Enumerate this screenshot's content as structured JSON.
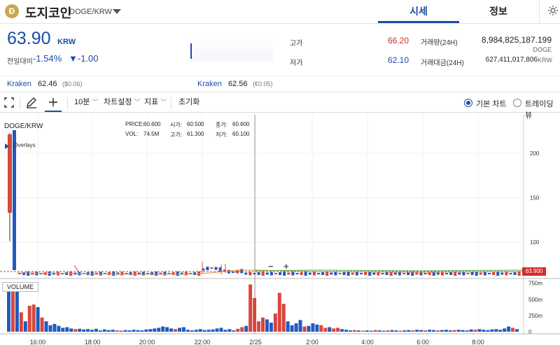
{
  "header": {
    "coin_symbol_glyph": "Ð",
    "coin_name": "도지코인",
    "pair": "DOGE/KRW",
    "tabs": [
      {
        "label": "시세",
        "active": true
      },
      {
        "label": "정보",
        "active": false
      }
    ]
  },
  "price": {
    "current": "63.90",
    "unit": "KRW",
    "change_label": "전일대비",
    "change_rate": "-1.54%",
    "change_amount": "▼-1.00"
  },
  "stats": {
    "high_label": "고가",
    "high_value": "66.20",
    "low_label": "저가",
    "low_value": "62.10",
    "volume_label": "거래량(24H)",
    "volume_value": "8,984,825,187.199",
    "volume_unit": "DOGE",
    "amount_label": "거래대금(24H)",
    "amount_value": "627,411,017,806",
    "amount_unit": "KRW"
  },
  "exchanges": [
    {
      "name": "Kraken",
      "price": "62.46",
      "conv": "($0.06)"
    },
    {
      "name": "Kraken",
      "price": "62.56",
      "conv": "(€0.05)"
    }
  ],
  "toolbar": {
    "interval": "10분",
    "chart_settings": "차트설정",
    "indicators": "지표",
    "reset": "초기화",
    "chart_modes": [
      {
        "label": "기본 차트",
        "selected": true
      },
      {
        "label": "트레이딩뷰",
        "selected": false
      }
    ]
  },
  "chart": {
    "symbol": "DOGE/KRW",
    "overlays_label": "Overlays",
    "volume_label": "VOLUME",
    "last_price_tag": "63.900",
    "ohlc": {
      "price_label": "PRICE:",
      "price": "60.600",
      "open_label": "시가:",
      "open": "60.500",
      "close_label": "종가:",
      "close": "60.600",
      "vol_label": "VOL:",
      "vol": "74.5M",
      "high_label": "고가:",
      "high": "61.300",
      "low_label": "저가:",
      "low": "60.100"
    },
    "zoom_minus": "−",
    "zoom_plus": "+",
    "colors": {
      "up": "#d8463c",
      "down": "#1f5bbf",
      "accent": "#1a4da5"
    }
  },
  "chart_data": {
    "type": "bar",
    "x_ticks": [
      "16:00",
      "18:00",
      "20:00",
      "22:00",
      "2/25",
      "2:00",
      "4:00",
      "6:00",
      "8:00"
    ],
    "price_axis": {
      "ticks": [
        "200",
        "150",
        "100"
      ],
      "values": [
        200,
        150,
        100
      ],
      "ylim": [
        60,
        215
      ]
    },
    "volume_axis": {
      "ticks": [
        "750m",
        "500m",
        "250m",
        "0"
      ],
      "values": [
        750,
        500,
        250,
        0
      ],
      "ylim": [
        0,
        800
      ]
    },
    "volume_series": [
      {
        "v": 680,
        "up": false
      },
      {
        "v": 680,
        "up": true
      },
      {
        "v": 680,
        "up": false
      },
      {
        "v": 300,
        "up": true
      },
      {
        "v": 160,
        "up": false
      },
      {
        "v": 400,
        "up": true
      },
      {
        "v": 420,
        "up": true
      },
      {
        "v": 380,
        "up": false
      },
      {
        "v": 220,
        "up": true
      },
      {
        "v": 160,
        "up": false
      },
      {
        "v": 100,
        "up": false
      },
      {
        "v": 120,
        "up": false
      },
      {
        "v": 90,
        "up": false
      },
      {
        "v": 60,
        "up": false
      },
      {
        "v": 70,
        "up": false
      },
      {
        "v": 50,
        "up": false
      },
      {
        "v": 40,
        "up": true
      },
      {
        "v": 45,
        "up": false
      },
      {
        "v": 35,
        "up": false
      },
      {
        "v": 40,
        "up": false
      },
      {
        "v": 30,
        "up": false
      },
      {
        "v": 45,
        "up": false
      },
      {
        "v": 20,
        "up": false
      },
      {
        "v": 35,
        "up": false
      },
      {
        "v": 25,
        "up": false
      },
      {
        "v": 30,
        "up": false
      },
      {
        "v": 20,
        "up": true
      },
      {
        "v": 15,
        "up": false
      },
      {
        "v": 25,
        "up": false
      },
      {
        "v": 20,
        "up": false
      },
      {
        "v": 30,
        "up": false
      },
      {
        "v": 25,
        "up": false
      },
      {
        "v": 20,
        "up": false
      },
      {
        "v": 35,
        "up": false
      },
      {
        "v": 40,
        "up": false
      },
      {
        "v": 50,
        "up": false
      },
      {
        "v": 60,
        "up": false
      },
      {
        "v": 80,
        "up": false
      },
      {
        "v": 70,
        "up": false
      },
      {
        "v": 50,
        "up": false
      },
      {
        "v": 40,
        "up": true
      },
      {
        "v": 60,
        "up": false
      },
      {
        "v": 70,
        "up": false
      },
      {
        "v": 30,
        "up": false
      },
      {
        "v": 20,
        "up": false
      },
      {
        "v": 30,
        "up": false
      },
      {
        "v": 40,
        "up": false
      },
      {
        "v": 25,
        "up": false
      },
      {
        "v": 30,
        "up": false
      },
      {
        "v": 35,
        "up": false
      },
      {
        "v": 50,
        "up": false
      },
      {
        "v": 60,
        "up": false
      },
      {
        "v": 30,
        "up": false
      },
      {
        "v": 40,
        "up": false
      },
      {
        "v": 20,
        "up": false
      },
      {
        "v": 45,
        "up": true
      },
      {
        "v": 70,
        "up": true
      },
      {
        "v": 90,
        "up": false
      },
      {
        "v": 730,
        "up": true
      },
      {
        "v": 520,
        "up": true
      },
      {
        "v": 160,
        "up": true
      },
      {
        "v": 220,
        "up": true
      },
      {
        "v": 190,
        "up": false
      },
      {
        "v": 140,
        "up": false
      },
      {
        "v": 280,
        "up": true
      },
      {
        "v": 600,
        "up": true
      },
      {
        "v": 430,
        "up": true
      },
      {
        "v": 160,
        "up": false
      },
      {
        "v": 100,
        "up": false
      },
      {
        "v": 130,
        "up": false
      },
      {
        "v": 180,
        "up": false
      },
      {
        "v": 80,
        "up": true
      },
      {
        "v": 90,
        "up": false
      },
      {
        "v": 130,
        "up": false
      },
      {
        "v": 110,
        "up": false
      },
      {
        "v": 100,
        "up": true
      },
      {
        "v": 60,
        "up": true
      },
      {
        "v": 70,
        "up": false
      },
      {
        "v": 50,
        "up": true
      },
      {
        "v": 60,
        "up": true
      },
      {
        "v": 40,
        "up": false
      },
      {
        "v": 30,
        "up": false
      },
      {
        "v": 20,
        "up": false
      },
      {
        "v": 25,
        "up": true
      },
      {
        "v": 20,
        "up": false
      },
      {
        "v": 15,
        "up": true
      },
      {
        "v": 20,
        "up": false
      },
      {
        "v": 15,
        "up": false
      },
      {
        "v": 25,
        "up": true
      },
      {
        "v": 20,
        "up": false
      },
      {
        "v": 15,
        "up": false
      },
      {
        "v": 20,
        "up": true
      },
      {
        "v": 25,
        "up": false
      },
      {
        "v": 20,
        "up": false
      },
      {
        "v": 15,
        "up": true
      },
      {
        "v": 20,
        "up": false
      },
      {
        "v": 25,
        "up": false
      },
      {
        "v": 20,
        "up": true
      },
      {
        "v": 30,
        "up": false
      },
      {
        "v": 25,
        "up": false
      },
      {
        "v": 20,
        "up": true
      },
      {
        "v": 30,
        "up": false
      },
      {
        "v": 25,
        "up": false
      },
      {
        "v": 20,
        "up": true
      },
      {
        "v": 25,
        "up": false
      },
      {
        "v": 30,
        "up": false
      },
      {
        "v": 20,
        "up": false
      },
      {
        "v": 25,
        "up": true
      },
      {
        "v": 30,
        "up": false
      },
      {
        "v": 25,
        "up": false
      },
      {
        "v": 20,
        "up": false
      },
      {
        "v": 35,
        "up": false
      },
      {
        "v": 30,
        "up": true
      },
      {
        "v": 40,
        "up": false
      },
      {
        "v": 30,
        "up": false
      },
      {
        "v": 25,
        "up": false
      },
      {
        "v": 35,
        "up": false
      },
      {
        "v": 40,
        "up": false
      },
      {
        "v": 30,
        "up": false
      },
      {
        "v": 50,
        "up": false
      },
      {
        "v": 80,
        "up": false
      },
      {
        "v": 60,
        "up": true
      },
      {
        "v": 40,
        "up": false
      }
    ]
  }
}
